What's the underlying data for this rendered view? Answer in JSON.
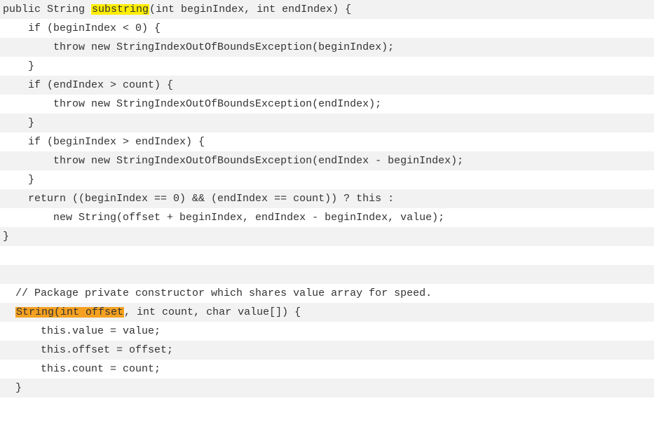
{
  "code": {
    "lines": [
      {
        "pre": "public String ",
        "hl": "substring",
        "hlClass": "hl-yellow",
        "post": "(int beginIndex, int endIndex) {"
      },
      {
        "pre": "    if (beginIndex < 0) {",
        "hl": "",
        "hlClass": "",
        "post": ""
      },
      {
        "pre": "        throw new StringIndexOutOfBoundsException(beginIndex);",
        "hl": "",
        "hlClass": "",
        "post": ""
      },
      {
        "pre": "    }",
        "hl": "",
        "hlClass": "",
        "post": ""
      },
      {
        "pre": "    if (endIndex > count) {",
        "hl": "",
        "hlClass": "",
        "post": ""
      },
      {
        "pre": "        throw new StringIndexOutOfBoundsException(endIndex);",
        "hl": "",
        "hlClass": "",
        "post": ""
      },
      {
        "pre": "    }",
        "hl": "",
        "hlClass": "",
        "post": ""
      },
      {
        "pre": "    if (beginIndex > endIndex) {",
        "hl": "",
        "hlClass": "",
        "post": ""
      },
      {
        "pre": "        throw new StringIndexOutOfBoundsException(endIndex - beginIndex);",
        "hl": "",
        "hlClass": "",
        "post": ""
      },
      {
        "pre": "    }",
        "hl": "",
        "hlClass": "",
        "post": ""
      },
      {
        "pre": "    return ((beginIndex == 0) && (endIndex == count)) ? this :",
        "hl": "",
        "hlClass": "",
        "post": ""
      },
      {
        "pre": "        new String(offset + beginIndex, endIndex - beginIndex, value);",
        "hl": "",
        "hlClass": "",
        "post": ""
      },
      {
        "pre": "}",
        "hl": "",
        "hlClass": "",
        "post": ""
      },
      {
        "pre": "",
        "hl": "",
        "hlClass": "",
        "post": ""
      },
      {
        "pre": "",
        "hl": "",
        "hlClass": "",
        "post": ""
      },
      {
        "pre": "  // Package private constructor which shares value array for speed.",
        "hl": "",
        "hlClass": "",
        "post": ""
      },
      {
        "pre": "  ",
        "hl": "String(int offset",
        "hlClass": "hl-orange",
        "post": ", int count, char value[]) {"
      },
      {
        "pre": "      this.value = value;",
        "hl": "",
        "hlClass": "",
        "post": ""
      },
      {
        "pre": "      this.offset = offset;",
        "hl": "",
        "hlClass": "",
        "post": ""
      },
      {
        "pre": "      this.count = count;",
        "hl": "",
        "hlClass": "",
        "post": ""
      },
      {
        "pre": "  }",
        "hl": "",
        "hlClass": "",
        "post": ""
      }
    ]
  }
}
